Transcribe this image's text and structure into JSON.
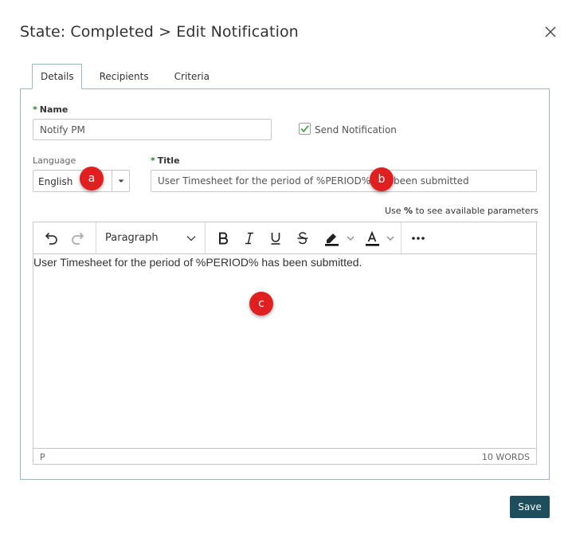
{
  "dialog": {
    "title": "State: Completed > Edit Notification",
    "close_icon": "close-icon"
  },
  "tabs": [
    {
      "label": "Details",
      "active": true
    },
    {
      "label": "Recipients",
      "active": false
    },
    {
      "label": "Criteria",
      "active": false
    }
  ],
  "form": {
    "name_required_marker": "*",
    "name_label": "Name",
    "name_value": "Notify PM",
    "send_notification_label": "Send Notification",
    "send_notification_checked": true,
    "language_label": "Language",
    "language_value": "English",
    "title_required_marker": "*",
    "title_label": "Title",
    "title_value": "User Timesheet for the period of %PERIOD% has been submitted",
    "hint_prefix": "Use ",
    "hint_symbol": "%",
    "hint_suffix": " to see available parameters"
  },
  "editor": {
    "toolbar": {
      "undo_icon": "undo-icon",
      "redo_icon": "redo-icon",
      "block_format": "Paragraph",
      "bold_icon": "bold-icon",
      "italic_icon": "italic-icon",
      "underline_icon": "underline-icon",
      "strikethrough_icon": "strikethrough-icon",
      "highlight_icon": "highlight-icon",
      "text_color_icon": "text-color-icon",
      "more_icon": "more-icon"
    },
    "body_text": "User Timesheet for the period of %PERIOD% has been submitted.",
    "status_path": "P",
    "word_count": "10 WORDS"
  },
  "markers": [
    "a",
    "b",
    "c"
  ],
  "footer": {
    "save_label": "Save"
  },
  "colors": {
    "accent": "#1e4d5c",
    "marker": "#e02020",
    "required": "#2e7d32",
    "checkmark": "#43a047",
    "border": "#9bb7c4"
  }
}
